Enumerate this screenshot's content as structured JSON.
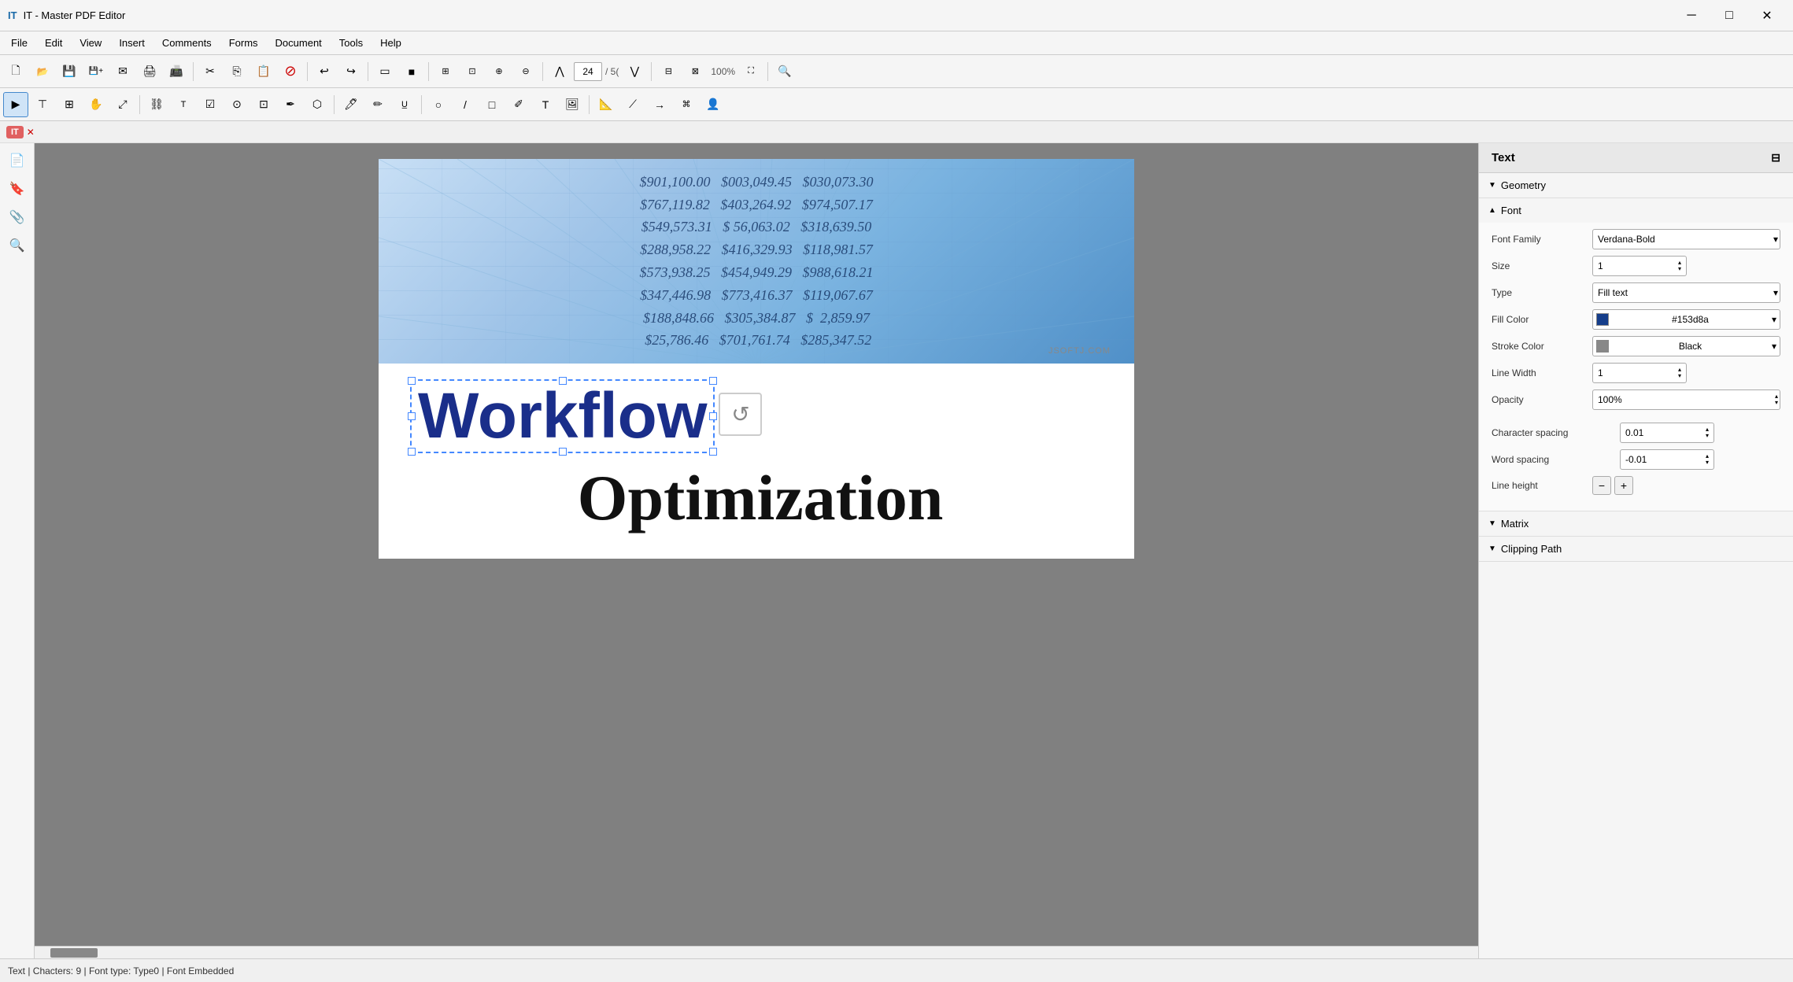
{
  "app": {
    "title": "IT - Master PDF Editor",
    "logo": "IT"
  },
  "titlebar": {
    "minimize": "─",
    "maximize": "□",
    "close": "✕"
  },
  "menubar": {
    "items": [
      "File",
      "Edit",
      "View",
      "Insert",
      "Comments",
      "Forms",
      "Document",
      "Tools",
      "Help"
    ]
  },
  "toolbar1": {
    "buttons": [
      "new",
      "open",
      "save",
      "saveas",
      "email",
      "print",
      "scan",
      "undo_save",
      "undo",
      "redo",
      "rect",
      "fill",
      "crop",
      "fit",
      "zoom_in",
      "zoom_out",
      "move",
      "resize",
      "prev",
      "next",
      "zoom_pct",
      "zoom_fit"
    ]
  },
  "toolbar2": {
    "buttons": [
      "select",
      "selecttext",
      "group",
      "hand",
      "resize2",
      "link",
      "field",
      "checkbox",
      "radio",
      "button",
      "signature",
      "stamp",
      "highlight",
      "pen",
      "underline",
      "ellipse",
      "line",
      "rect2",
      "pencil",
      "textbox",
      "image",
      "measure",
      "linemark",
      "arrowmark",
      "combo"
    ]
  },
  "modebar": {
    "mode": "IT",
    "badge_color": "#d04040"
  },
  "pdf": {
    "numbers": [
      "$901,100.00  $003,049.45  $030,073.30",
      "$767,119.82  $403,264.92  $974,507.17",
      "$549,573.31  $ 56,063.02  $318,639.50",
      "$288,958.22  $416,329.93  $118,981.57",
      "$573,938.25  $454,949.29  $988,618.21",
      "$347,446.98  $773,416.37  $119,067.67",
      "$188,848.66  $305,384.87  $2,859.97",
      "$25,786.46  $701,761.74  $285,347.52"
    ],
    "watermark": "JSOFTJ.COM",
    "workflow_text": "Workflow",
    "optimization_text": "Optimization"
  },
  "right_panel": {
    "title": "Text",
    "adjust_icon": "⊟",
    "sections": {
      "geometry": {
        "label": "Geometry",
        "collapsed": false
      },
      "font": {
        "label": "Font",
        "expanded": true,
        "fields": {
          "font_family_label": "Font Family",
          "font_family_value": "Verdana-Bold",
          "size_label": "Size",
          "size_value": "1",
          "type_label": "Type",
          "type_value": "Fill text",
          "fill_color_label": "Fill Color",
          "fill_color_value": "#153d8a",
          "fill_color_hex": "#153d8a",
          "stroke_color_label": "Stroke Color",
          "stroke_color_value": "Black",
          "line_width_label": "Line Width",
          "line_width_value": "1",
          "opacity_label": "Opacity",
          "opacity_value": "100%",
          "char_spacing_label": "Character spacing",
          "char_spacing_value": "0.01",
          "word_spacing_label": "Word spacing",
          "word_spacing_value": "-0.01",
          "line_height_label": "Line height"
        }
      },
      "matrix": {
        "label": "Matrix",
        "collapsed": false
      },
      "clipping_path": {
        "label": "Clipping Path",
        "collapsed": false
      }
    }
  },
  "statusbar": {
    "text": "Text | Chacters: 9 | Font type: Type0 | Font Embedded"
  },
  "sidebar": {
    "icons": [
      "📄",
      "🔖",
      "📎",
      "🔍"
    ]
  }
}
